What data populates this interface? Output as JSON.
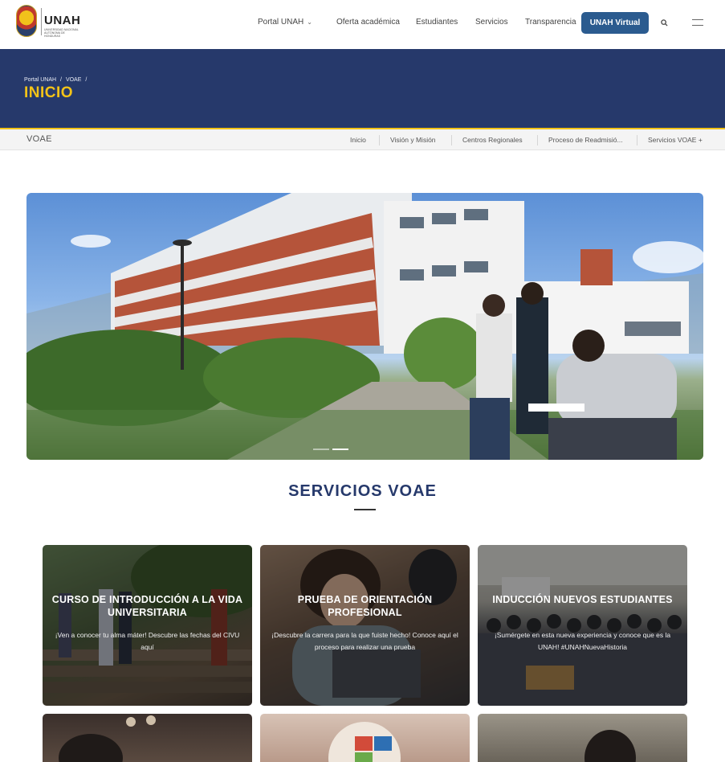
{
  "topnav": {
    "brand": "UNAH",
    "brand_sub": "UNIVERSIDAD NACIONAL AUTÓNOMA DE HONDURAS",
    "items": [
      "Portal UNAH",
      "Oferta académica",
      "Estudiantes",
      "Servicios",
      "Transparencia"
    ],
    "virtual_button": "UNAH Virtual"
  },
  "header": {
    "breadcrumb": [
      "Portal UNAH",
      "/",
      "VOAE",
      "/"
    ],
    "title": "INICIO"
  },
  "subnav": {
    "title": "VOAE",
    "items": [
      "Inicio",
      "Visión y Misión",
      "Centros Regionales",
      "Proceso de Readmisió...",
      "Servicios VOAE +"
    ]
  },
  "slider": {
    "slide_count": 2,
    "active_index": 1
  },
  "section": {
    "title": "SERVICIOS VOAE"
  },
  "cards": [
    {
      "title": "CURSO DE INTRODUCCIÓN A LA VIDA UNIVERSITARIA",
      "text": "¡Ven a conocer tu alma máter! Descubre las fechas del CIVU aquí"
    },
    {
      "title": "PRUEBA DE ORIENTACIÓN PROFESIONAL",
      "text": "¡Descubre la carrera para la que fuiste hecho! Conoce aquí el proceso para realizar una prueba"
    },
    {
      "title": "INDUCCIÓN NUEVOS ESTUDIANTES",
      "text": "¡Sumérgete en esta nueva experiencia y conoce que es la UNAH! #UNAHNuevaHistoria"
    }
  ],
  "colors": {
    "primary_navy": "#26396b",
    "accent_gold": "#f3c318",
    "button_blue": "#2b5b8f"
  },
  "icons": [
    "search-icon",
    "hamburger-menu-icon",
    "chevron-down-icon"
  ]
}
